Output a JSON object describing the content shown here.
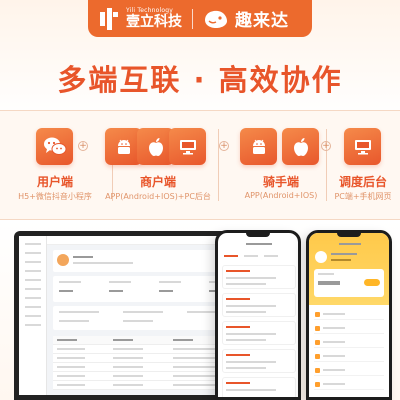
{
  "brand": {
    "en": "Yili Technology",
    "cn": "壹立科技",
    "partner_cn": "趣来达"
  },
  "headline": "多端互联 · 高效协作",
  "groups": [
    {
      "title": "用户端",
      "subtitle": "H5+微信抖音小程序",
      "icons": [
        "wechat-icon"
      ]
    },
    {
      "title": "商户端",
      "subtitle": "APP(Android+IOS)+PC后台",
      "icons": [
        "android-icon",
        "apple-icon",
        "monitor-icon"
      ]
    },
    {
      "title": "骑手端",
      "subtitle": "APP(Android+IOS)",
      "icons": [
        "android-icon",
        "apple-icon"
      ]
    },
    {
      "title": "调度后台",
      "subtitle": "PC端+手机网页",
      "icons": [
        "monitor-icon"
      ]
    }
  ],
  "colors": {
    "accent": "#e8552a",
    "brand_bar": "#ec6a2d",
    "rider_yellow": "#ffc94a"
  }
}
